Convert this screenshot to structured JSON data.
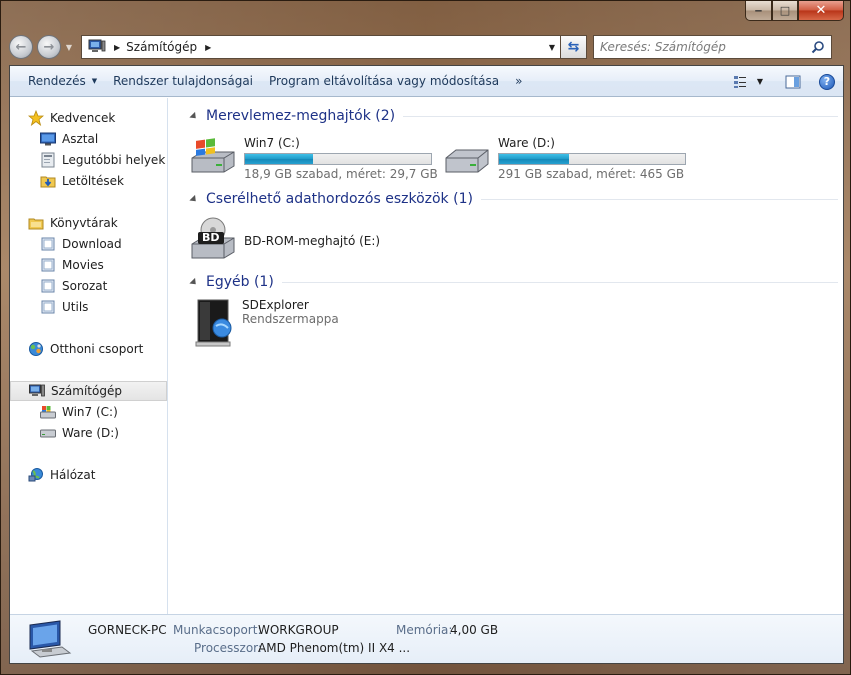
{
  "window": {
    "caption_buttons": {
      "minimize": "‒",
      "maximize": "□",
      "close": "✕"
    }
  },
  "address": {
    "crumbs": [
      "Számítógép"
    ],
    "search_placeholder": "Keresés: Számítógép"
  },
  "toolbar": {
    "organize": "Rendezés",
    "system_properties": "Rendszer tulajdonságai",
    "uninstall": "Program eltávolítása vagy módosítása",
    "more": "»"
  },
  "navpane": {
    "favorites": "Kedvencek",
    "desktop": "Asztal",
    "recent": "Legutóbbi helyek",
    "downloads": "Letöltések",
    "libraries": "Könyvtárak",
    "lib_download": "Download",
    "lib_movies": "Movies",
    "lib_sorozat": "Sorozat",
    "lib_utils": "Utils",
    "homegroup": "Otthoni csoport",
    "computer": "Számítógép",
    "drive_c": "Win7 (C:)",
    "drive_d": "Ware (D:)",
    "network": "Hálózat"
  },
  "groups": {
    "hdd": "Merevlemez-meghajtók (2)",
    "removable": "Cserélhető adathordozós eszközök (1)",
    "other": "Egyéb (1)"
  },
  "drives": [
    {
      "name": "Win7 (C:)",
      "info": "18,9 GB szabad, méret: 29,7 GB",
      "used_fraction": 0.364
    },
    {
      "name": "Ware (D:)",
      "info": "291 GB szabad, méret: 465 GB",
      "used_fraction": 0.374
    }
  ],
  "removable": {
    "name": "BD-ROM-meghajtó (E:)",
    "badge": "BD"
  },
  "other": {
    "name": "SDExplorer",
    "sub": "Rendszermappa"
  },
  "details": {
    "pc_name": "GORNECK-PC",
    "workgroup_label": "Munkacsoport:",
    "workgroup": "WORKGROUP",
    "memory_label": "Memória:",
    "memory": "4,00 GB",
    "cpu_label": "Processzor:",
    "cpu": "AMD Phenom(tm) II X4 ..."
  },
  "colors": {
    "group_heading": "#1e3287",
    "bar_fill": "#1e9ac8",
    "toolbar_text": "#1e395b"
  }
}
